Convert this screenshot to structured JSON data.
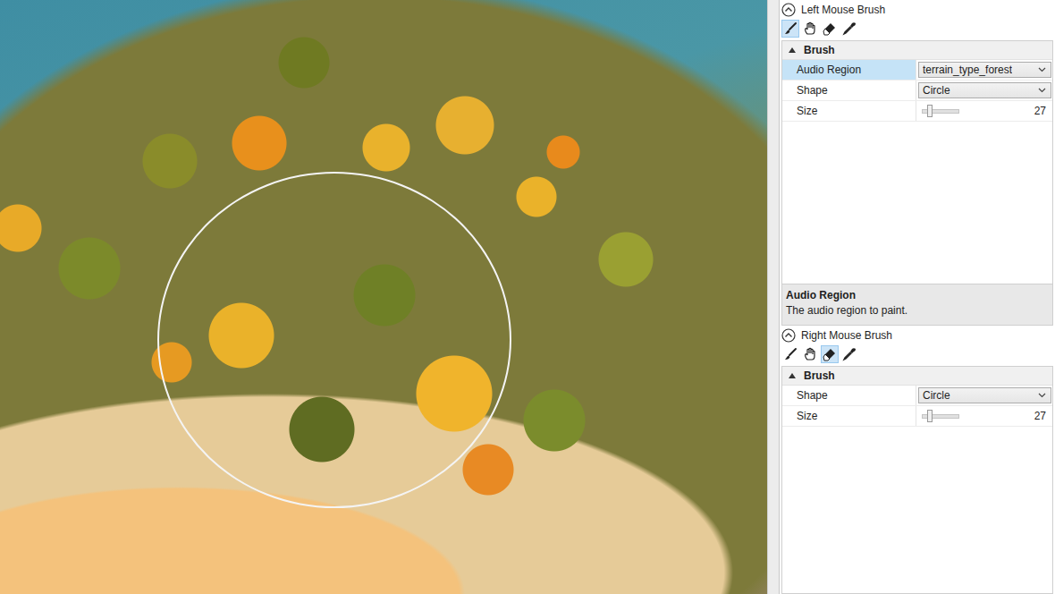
{
  "panels": [
    {
      "title": "Left Mouse Brush",
      "expanded": true,
      "tools": [
        {
          "kind": "brush",
          "selected": true
        },
        {
          "kind": "smudge",
          "selected": false
        },
        {
          "kind": "eraser",
          "selected": false
        },
        {
          "kind": "picker",
          "selected": false
        }
      ],
      "group": {
        "label": "Brush",
        "expanded": true,
        "properties": [
          {
            "kind": "dropdown",
            "label": "Audio Region",
            "value": "terrain_type_forest",
            "selected": true
          },
          {
            "kind": "dropdown",
            "label": "Shape",
            "value": "Circle",
            "selected": false
          },
          {
            "kind": "slider",
            "label": "Size",
            "value": "27",
            "level": 0.2,
            "selected": false
          }
        ]
      },
      "description": {
        "title": "Audio Region",
        "text": "The audio region to paint."
      }
    },
    {
      "title": "Right Mouse Brush",
      "expanded": true,
      "tools": [
        {
          "kind": "brush",
          "selected": false
        },
        {
          "kind": "smudge",
          "selected": false
        },
        {
          "kind": "eraser",
          "selected": true
        },
        {
          "kind": "picker",
          "selected": false
        }
      ],
      "group": {
        "label": "Brush",
        "expanded": true,
        "properties": [
          {
            "kind": "dropdown",
            "label": "Shape",
            "value": "Circle",
            "selected": false
          },
          {
            "kind": "slider",
            "label": "Size",
            "value": "27",
            "level": 0.2,
            "selected": false
          }
        ]
      },
      "description": null
    }
  ]
}
